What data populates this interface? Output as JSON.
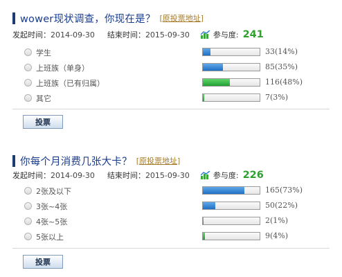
{
  "polls": [
    {
      "title": "wower现状调查，你现在是？",
      "orig_link_prefix": "[",
      "orig_link": "原投票地址",
      "orig_link_suffix": "]",
      "start_label": "发起时间：",
      "start_date": "2014-09-30",
      "end_label": "结束时间：",
      "end_date": "2015-09-30",
      "participation_label": "参与度:",
      "participation_count": "241",
      "options": [
        {
          "label": "学生",
          "result": "33(14%)",
          "percent": 14,
          "color": "blue"
        },
        {
          "label": "上班族（单身）",
          "result": "85(35%)",
          "percent": 35,
          "color": "blue"
        },
        {
          "label": "上班族（已有归属）",
          "result": "116(48%)",
          "percent": 48,
          "color": "green"
        },
        {
          "label": "其它",
          "result": "7(3%)",
          "percent": 3,
          "color": "green"
        }
      ],
      "vote_label": "投票"
    },
    {
      "title": "你每个月消费几张大卡？",
      "orig_link_prefix": "[",
      "orig_link": "原投票地址",
      "orig_link_suffix": "]",
      "start_label": "发起时间：",
      "start_date": "2014-09-30",
      "end_label": "结束时间：",
      "end_date": "2015-09-30",
      "participation_label": "参与度:",
      "participation_count": "226",
      "options": [
        {
          "label": "2张及以下",
          "result": "165(73%)",
          "percent": 73,
          "color": "blue"
        },
        {
          "label": "3张~4张",
          "result": "50(22%)",
          "percent": 22,
          "color": "blue"
        },
        {
          "label": "4张~5张",
          "result": "2(1%)",
          "percent": 1,
          "color": "green"
        },
        {
          "label": "5张以上",
          "result": "9(4%)",
          "percent": 4,
          "color": "green"
        }
      ],
      "vote_label": "投票"
    }
  ],
  "colors": {
    "title": "#1a3d8f",
    "link": "#a57a28",
    "participation": "#2fa02f",
    "bar_blue": "#1f6fc4",
    "bar_green": "#22a034"
  },
  "icons": {
    "participation": "trend-chart-icon"
  }
}
